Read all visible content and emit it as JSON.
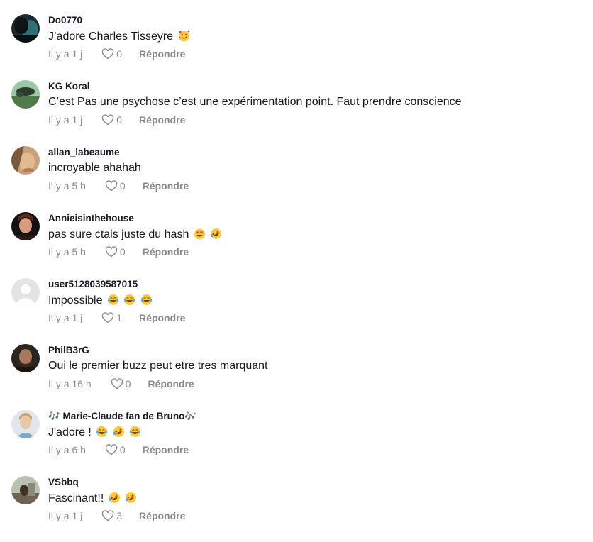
{
  "comments": [
    {
      "username": "Do0770",
      "text": "J’adore Charles Tisseyre",
      "emojis": [
        "smiling-face-with-hearts"
      ],
      "time": "Il y a 1 j",
      "likes": "0",
      "reply": "Répondre",
      "avatar": "dark-photo"
    },
    {
      "username": "KG Koral",
      "text": "C’est Pas une psychose c’est une expérimentation point. Faut prendre conscience",
      "emojis": [],
      "time": "Il y a 1 j",
      "likes": "0",
      "reply": "Répondre",
      "avatar": "green-photo"
    },
    {
      "username": "allan_labeaume",
      "text": "incroyable ahahah",
      "emojis": [],
      "time": "Il y a 5 h",
      "likes": "0",
      "reply": "Répondre",
      "avatar": "face-photo"
    },
    {
      "username": "Annieisinthehouse",
      "text": "pas sure ctais juste du hash",
      "emojis": [
        "face-with-hearts-laughing",
        "rolling-on-floor-laughing"
      ],
      "time": "Il y a 5 h",
      "likes": "0",
      "reply": "Répondre",
      "avatar": "woman-photo"
    },
    {
      "username": "user5128039587015",
      "text": "Impossible",
      "emojis": [
        "tears-of-joy",
        "tears-of-joy",
        "tears-of-joy"
      ],
      "time": "Il y a 1 j",
      "likes": "1",
      "reply": "Répondre",
      "avatar": "default-avatar"
    },
    {
      "username": "PhilB3rG",
      "text": "Oui le premier buzz peut etre tres marquant",
      "emojis": [],
      "time": "Il y a 16 h",
      "likes": "0",
      "reply": "Répondre",
      "avatar": "man-photo"
    },
    {
      "username": "🎶 Marie-Claude fan de Bruno🎶",
      "text": "J'adore !",
      "emojis": [
        "tears-of-joy",
        "rolling-on-floor-laughing",
        "tears-of-joy"
      ],
      "time": "Il y a 6 h",
      "likes": "0",
      "reply": "Répondre",
      "avatar": "light-photo"
    },
    {
      "username": "VSbbq",
      "text": "Fascinant!!",
      "emojis": [
        "rolling-on-floor-laughing",
        "rolling-on-floor-laughing"
      ],
      "time": "Il y a 1 j",
      "likes": "3",
      "reply": "Répondre",
      "avatar": "outdoor-photo"
    }
  ],
  "colors": {
    "text": "#161823",
    "muted": "#8a8b91",
    "emoji_yellow": "#ffc83d"
  }
}
